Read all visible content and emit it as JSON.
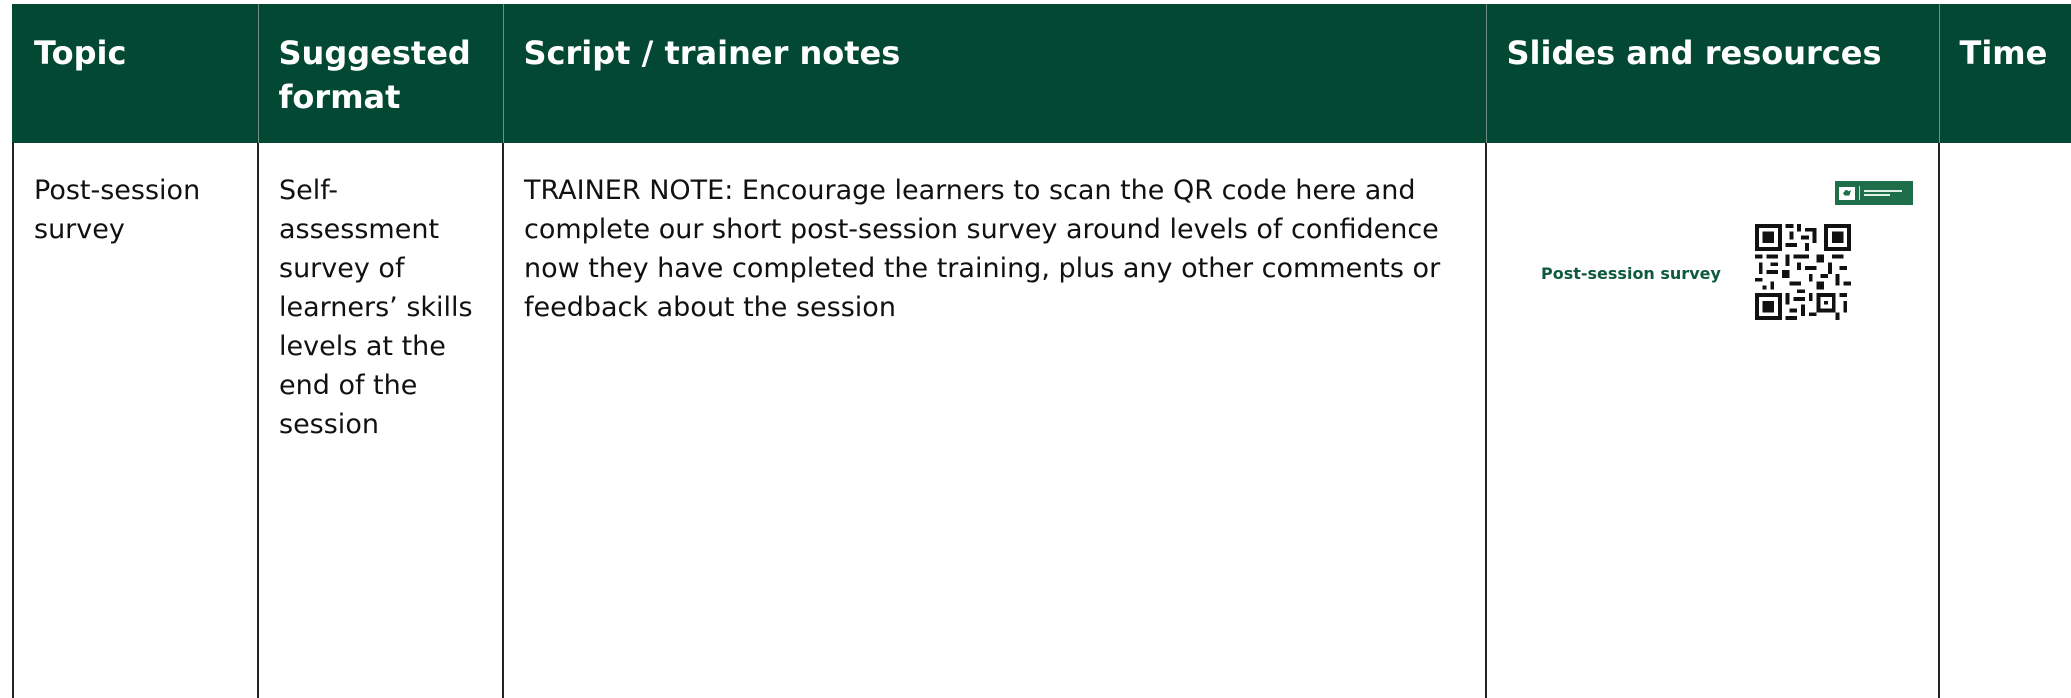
{
  "table": {
    "headers": [
      "Topic",
      "Suggested format",
      "Script / trainer notes",
      "Slides and resources",
      "Time"
    ],
    "row": {
      "topic": "Post-session survey",
      "format": "Self-assessment survey of learners’ skills levels at the end of the session",
      "notes": "TRAINER NOTE: Encourage learners to scan the QR code here and complete our short post-session survey around levels of confidence now they have completed the training, plus any other comments or feedback about the session",
      "slide_title": "Post-session survey",
      "time": ""
    }
  },
  "colors": {
    "header_bg": "#024833",
    "header_text": "#ffffff",
    "slide_accent": "#0f5a3c"
  },
  "icons": {
    "logo": "lloyds-bank-academy-logo",
    "qr": "qr-code-icon"
  }
}
